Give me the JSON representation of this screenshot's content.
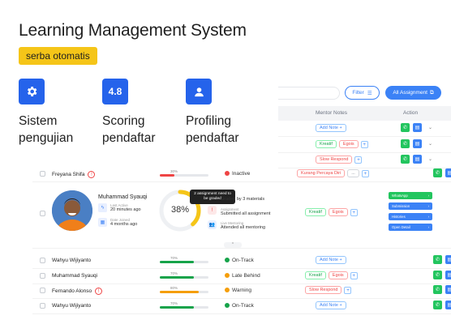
{
  "hero": {
    "title": "Learning Management System",
    "tagline": "serba otomatis"
  },
  "features": [
    {
      "icon": "gear-icon",
      "glyph": "",
      "label": "Sistem\npengujian"
    },
    {
      "icon": "score-icon",
      "glyph": "4.8",
      "label": "Scoring\npendaftar"
    },
    {
      "icon": "user-icon",
      "glyph": "",
      "label": "Profiling\npendaftar"
    }
  ],
  "toolbar": {
    "filter_label": "Filter",
    "all_label": "All Assignment"
  },
  "table": {
    "headers": {
      "notes": "Mentor Notes",
      "action": "Action"
    },
    "partial_rows": [
      {
        "notes": [
          {
            "text": "Add Note",
            "color": "blue",
            "plus": false
          }
        ]
      },
      {
        "notes": [
          {
            "text": "Kreatif",
            "color": "green"
          },
          {
            "text": "Egois",
            "color": "red"
          },
          {
            "text": "+",
            "color": "plus"
          }
        ]
      },
      {
        "notes": [
          {
            "text": "Slow Respond",
            "color": "red"
          },
          {
            "text": "+",
            "color": "plus"
          }
        ]
      }
    ],
    "rows": [
      {
        "name": "Freyana Shifa",
        "warn": true,
        "percent_label": "30%",
        "progress": 0.3,
        "bar_color": "#ef4444",
        "status": "Inactive",
        "status_color": "#ef4444",
        "notes": [
          {
            "text": "Kurang Percaya Diri",
            "color": "red"
          },
          {
            "text": "...",
            "color": "gray"
          },
          {
            "text": "+",
            "color": "plus"
          }
        ]
      },
      {
        "name": "Wahyu Wijiyanto",
        "warn": false,
        "percent_label": "70%",
        "progress": 0.7,
        "bar_color": "#16a34a",
        "status": "On-Track",
        "status_color": "#16a34a",
        "notes": [
          {
            "text": "Add Note",
            "color": "blue"
          }
        ]
      },
      {
        "name": "Muhammad Syauqi",
        "warn": false,
        "percent_label": "70%",
        "progress": 0.7,
        "bar_color": "#16a34a",
        "status": "Late Behind",
        "status_color": "#f59e0b",
        "notes": [
          {
            "text": "Kreatif",
            "color": "green"
          },
          {
            "text": "Egois",
            "color": "red"
          },
          {
            "text": "+",
            "color": "plus"
          }
        ]
      },
      {
        "name": "Fernando Alonso",
        "warn": true,
        "percent_label": "80%",
        "progress": 0.8,
        "bar_color": "#f59e0b",
        "status": "Warning",
        "status_color": "#f59e0b",
        "notes": [
          {
            "text": "Slow Respond",
            "color": "red"
          },
          {
            "text": "+",
            "color": "plus"
          }
        ]
      },
      {
        "name": "Wahyu Wijiyanto",
        "warn": false,
        "percent_label": "70%",
        "progress": 0.7,
        "bar_color": "#16a34a",
        "status": "On-Track",
        "status_color": "#16a34a",
        "notes": [
          {
            "text": "Add Note",
            "color": "blue"
          }
        ]
      }
    ],
    "expanded": {
      "name": "Muhammad Syauqi",
      "last_active_label": "Last Active",
      "last_active": "20 minutes ago",
      "date_joined_label": "Date Joined",
      "date_joined": "4 months ago",
      "percent": "38%",
      "progress": 0.38,
      "tooltip": "2 assignment need to be graded",
      "graded_text": "Graded by 3 materials",
      "assignment_label": "Assignment",
      "assignment_text": "Submitted all assignment",
      "mentoring_label": "Live Mentoring",
      "mentoring_text": "Attended all mentoring",
      "notes": [
        {
          "text": "Kreatif",
          "color": "green"
        },
        {
          "text": "Egois",
          "color": "red"
        },
        {
          "text": "+",
          "color": "plus"
        }
      ],
      "buttons": [
        {
          "label": "WhatsApp",
          "color": "#22c55e"
        },
        {
          "label": "Submission",
          "color": "#3b82f6"
        },
        {
          "label": "Histories",
          "color": "#3b82f6"
        },
        {
          "label": "Open Detail",
          "color": "#3b82f6"
        }
      ]
    }
  }
}
